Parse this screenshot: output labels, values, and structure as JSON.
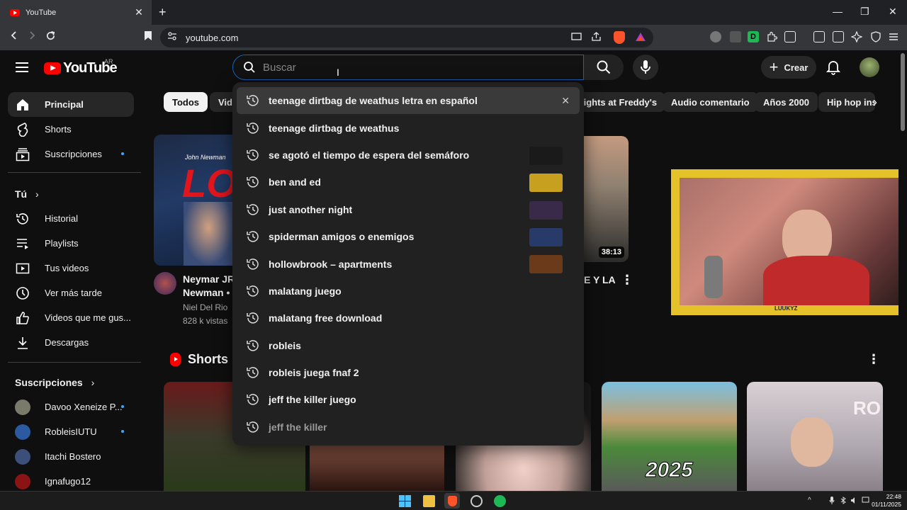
{
  "browser": {
    "tab_title": "YouTube",
    "tab_close": "✕",
    "new_tab": "+",
    "url": "youtube.com",
    "window_controls": [
      "—",
      "❐",
      "✕"
    ]
  },
  "header": {
    "logo_text": "YouTube",
    "country_code": "AR",
    "search_placeholder": "Buscar",
    "create_label": "Crear",
    "create_plus": "+"
  },
  "sidebar": {
    "main_items": [
      {
        "label": "Principal",
        "icon": "home-icon",
        "active": true
      },
      {
        "label": "Shorts",
        "icon": "shorts-icon"
      },
      {
        "label": "Suscripciones",
        "icon": "subscriptions-icon",
        "dot": true
      }
    ],
    "you_heading": "Tú",
    "you_chevron": "›",
    "you_items": [
      {
        "label": "Historial",
        "icon": "history-icon"
      },
      {
        "label": "Playlists",
        "icon": "playlists-icon"
      },
      {
        "label": "Tus videos",
        "icon": "your-videos-icon"
      },
      {
        "label": "Ver más tarde",
        "icon": "watch-later-icon"
      },
      {
        "label": "Videos que me gus...",
        "icon": "liked-icon"
      },
      {
        "label": "Descargas",
        "icon": "downloads-icon"
      }
    ],
    "subs_heading": "Suscripciones",
    "subs_chevron": "›",
    "subscriptions": [
      {
        "name": "Davoo Xeneize P...",
        "color": "#7a7a6a",
        "dot": true
      },
      {
        "name": "RobleisIUTU",
        "color": "#2c5aa0",
        "dot": true
      },
      {
        "name": "Itachi Bostero",
        "color": "#3b4f7a"
      },
      {
        "name": "Ignafugo12",
        "color": "#8a1414"
      }
    ]
  },
  "chips": {
    "items": [
      "Todos",
      "Vide",
      "lights at Freddy's",
      "Audio comentario",
      "Años 2000",
      "Hip hop inst"
    ],
    "active": "Todos",
    "next": "›"
  },
  "search_suggestions": [
    {
      "text": "teenage dirtbag de weathus letra en español",
      "highlighted": true,
      "remove": "✕"
    },
    {
      "text": "teenage dirtbag de weathus"
    },
    {
      "text": "se agotó el tiempo de espera del semáforo",
      "thumb": "#1a1a1a"
    },
    {
      "text": "ben and ed",
      "thumb": "#c8a020"
    },
    {
      "text": "just another night",
      "thumb": "#3a2a4a"
    },
    {
      "text": "spiderman amigos o enemigos",
      "thumb": "#283a6a"
    },
    {
      "text": "hollowbrook – apartments",
      "thumb": "#6a3a1a"
    },
    {
      "text": "malatang juego"
    },
    {
      "text": "malatang free download"
    },
    {
      "text": "robleis"
    },
    {
      "text": "robleis juega fnaf 2"
    },
    {
      "text": "jeff the killer juego"
    },
    {
      "text": "jeff the killer",
      "dim": true
    }
  ],
  "videos": {
    "left_title_line1": "Neymar JR",
    "left_title_line2": "Newman • S",
    "left_channel": "Niel Del Rio",
    "left_views": "828 k vistas",
    "left_thumb_text": "LO",
    "left_thumb_caption": "John Newman",
    "mid_title": "E Y LA",
    "mid_duration": "38:13",
    "right_stream_label": "LUUKYZ",
    "kebab": "⋮"
  },
  "shorts": {
    "heading": "Shorts",
    "kebab": "⋮",
    "mario_year": "2025",
    "right_text": "RO"
  },
  "taskbar": {
    "time": "22:48",
    "date": "01/11/2025",
    "tray_chevron": "^"
  }
}
